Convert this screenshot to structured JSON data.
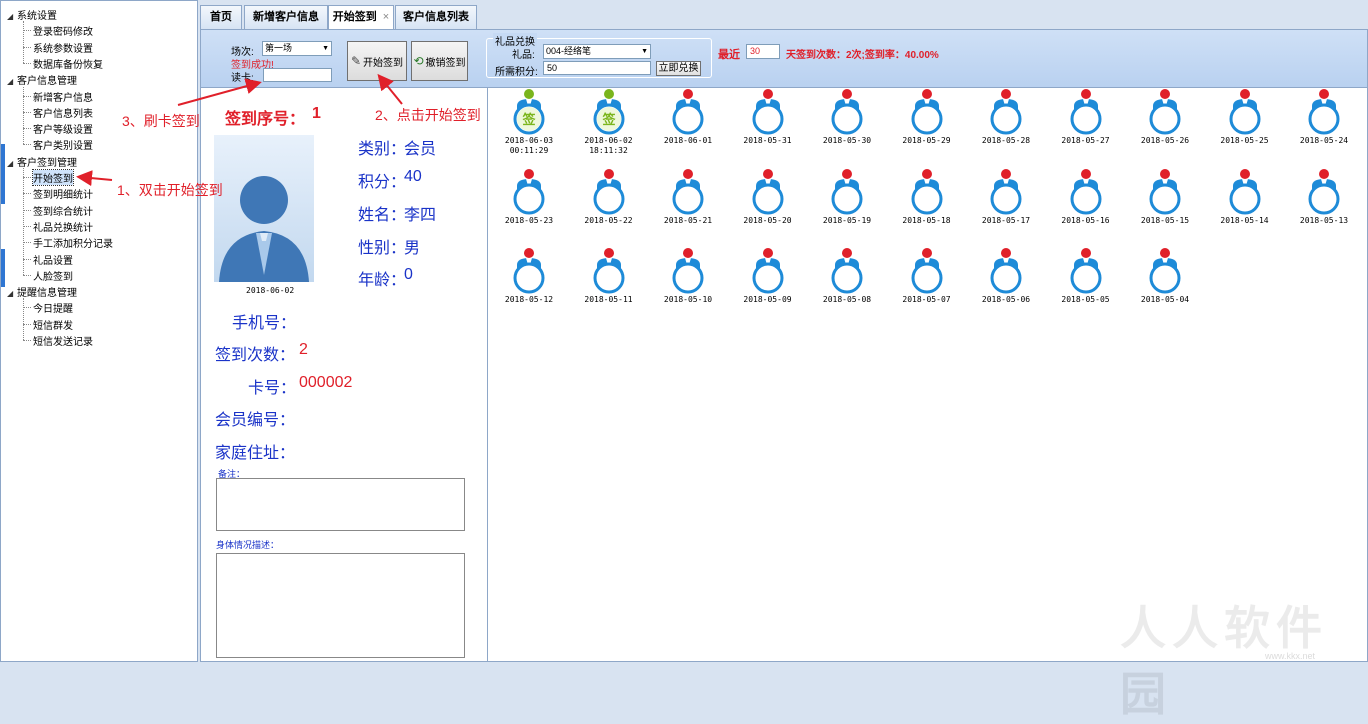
{
  "sidebar": {
    "groups": [
      {
        "label": "系统设置",
        "children": [
          "登录密码修改",
          "系统参数设置",
          "数据库备份恢复"
        ]
      },
      {
        "label": "客户信息管理",
        "children": [
          "新增客户信息",
          "客户信息列表",
          "客户等级设置",
          "客户类别设置"
        ]
      },
      {
        "label": "客户签到管理",
        "children": [
          "开始签到",
          "签到明细统计",
          "签到综合统计",
          "礼品兑换统计",
          "手工添加积分记录",
          "礼品设置",
          "人脸签到"
        ]
      },
      {
        "label": "提醒信息管理",
        "children": [
          "今日提醒",
          "短信群发",
          "短信发送记录"
        ]
      }
    ],
    "selected": "开始签到"
  },
  "tabs": [
    {
      "label": "首页"
    },
    {
      "label": "新增客户信息"
    },
    {
      "label": "开始签到",
      "close": "×"
    },
    {
      "label": "客户信息列表"
    }
  ],
  "toolbar": {
    "session_label": "场次:",
    "session_value": "第一场",
    "success_text": "签到成功!",
    "card_label": "读卡:",
    "card_value": "",
    "start_button": "开始签到",
    "cancel_button": "撤销签到",
    "gift_group_title": "礼品兑换",
    "gift_label": "礼品:",
    "gift_value": "004-经络笔",
    "points_label": "所需积分:",
    "points_value": "50",
    "redeem_button": "立即兑换",
    "recent_label": "最近",
    "recent_days": "30",
    "recent_stats": "天签到次数：2次;签到率：40.00%"
  },
  "info": {
    "seq_label": "签到序号：",
    "seq_value": "1",
    "photo_date": "2018-06-02",
    "category_label": "类别：",
    "category_value": "会员",
    "points_label": "积分：",
    "points_value": "40",
    "name_label": "姓名：",
    "name_value": "李四",
    "gender_label": "性别：",
    "gender_value": "男",
    "age_label": "年龄：",
    "age_value": "0",
    "phone_label": "手机号：",
    "phone_value": "",
    "count_label": "签到次数：",
    "count_value": "2",
    "card_label": "卡号：",
    "card_value": "000002",
    "member_label": "会员编号：",
    "member_value": "",
    "address_label": "家庭住址：",
    "address_value": "",
    "remark_label": "备注：",
    "health_label": "身体情况描述："
  },
  "sign_badge": "签",
  "dates": [
    {
      "date": "2018-06-03",
      "time": "00:11:29",
      "signed": true
    },
    {
      "date": "2018-06-02",
      "time": "18:11:32",
      "signed": true
    },
    {
      "date": "2018-06-01",
      "signed": false
    },
    {
      "date": "2018-05-31",
      "signed": false
    },
    {
      "date": "2018-05-30",
      "signed": false
    },
    {
      "date": "2018-05-29",
      "signed": false
    },
    {
      "date": "2018-05-28",
      "signed": false
    },
    {
      "date": "2018-05-27",
      "signed": false
    },
    {
      "date": "2018-05-26",
      "signed": false
    },
    {
      "date": "2018-05-25",
      "signed": false
    },
    {
      "date": "2018-05-24",
      "signed": false
    },
    {
      "date": "2018-05-23",
      "signed": false
    },
    {
      "date": "2018-05-22",
      "signed": false
    },
    {
      "date": "2018-05-21",
      "signed": false
    },
    {
      "date": "2018-05-20",
      "signed": false
    },
    {
      "date": "2018-05-19",
      "signed": false
    },
    {
      "date": "2018-05-18",
      "signed": false
    },
    {
      "date": "2018-05-17",
      "signed": false
    },
    {
      "date": "2018-05-16",
      "signed": false
    },
    {
      "date": "2018-05-15",
      "signed": false
    },
    {
      "date": "2018-05-14",
      "signed": false
    },
    {
      "date": "2018-05-13",
      "signed": false
    },
    {
      "date": "2018-05-12",
      "signed": false
    },
    {
      "date": "2018-05-11",
      "signed": false
    },
    {
      "date": "2018-05-10",
      "signed": false
    },
    {
      "date": "2018-05-09",
      "signed": false
    },
    {
      "date": "2018-05-08",
      "signed": false
    },
    {
      "date": "2018-05-07",
      "signed": false
    },
    {
      "date": "2018-05-06",
      "signed": false
    },
    {
      "date": "2018-05-05",
      "signed": false
    },
    {
      "date": "2018-05-04",
      "signed": false
    }
  ],
  "annotations": {
    "step1": "1、双击开始签到",
    "step2": "2、点击开始签到",
    "step3": "3、刷卡签到"
  },
  "watermark": "人人软件园",
  "watermark_url": "www.kkx.net",
  "colors": {
    "accent_blue": "#1a33c8",
    "alert_red": "#e0202a",
    "signed_green": "#7ab51d",
    "toolbar_blue": "#b9d1f0",
    "icon_blue": "#1e8bd8"
  }
}
